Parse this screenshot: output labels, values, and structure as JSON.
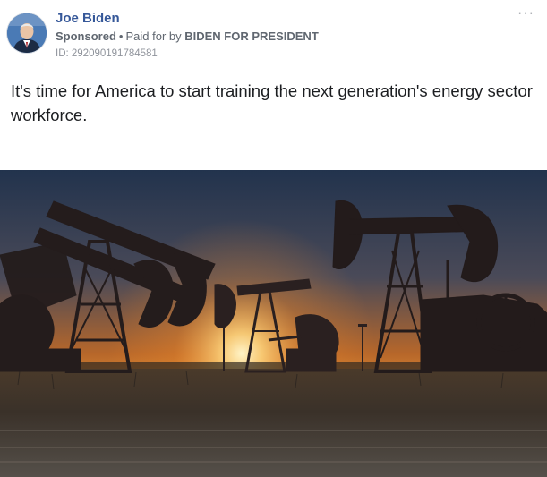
{
  "post": {
    "author": "Joe Biden",
    "sponsored_label": "Sponsored",
    "paid_prefix": "Paid for by",
    "payer": "BIDEN FOR PRESIDENT",
    "ad_id": "ID: 292090191784581",
    "more_icon": "···",
    "message": "It's time for America to start training the next generation's energy sector workforce."
  },
  "image": {
    "subject": "oil-pumpjacks-sunset",
    "colors": {
      "sky_top": "#1f3550",
      "sky_glow": "#f5a623",
      "sun": "#fff3c0",
      "silhouette": "#2b2222",
      "ground": "#3a342c"
    }
  },
  "icons": {
    "avatar": "profile-photo",
    "more": "more-options-icon"
  }
}
